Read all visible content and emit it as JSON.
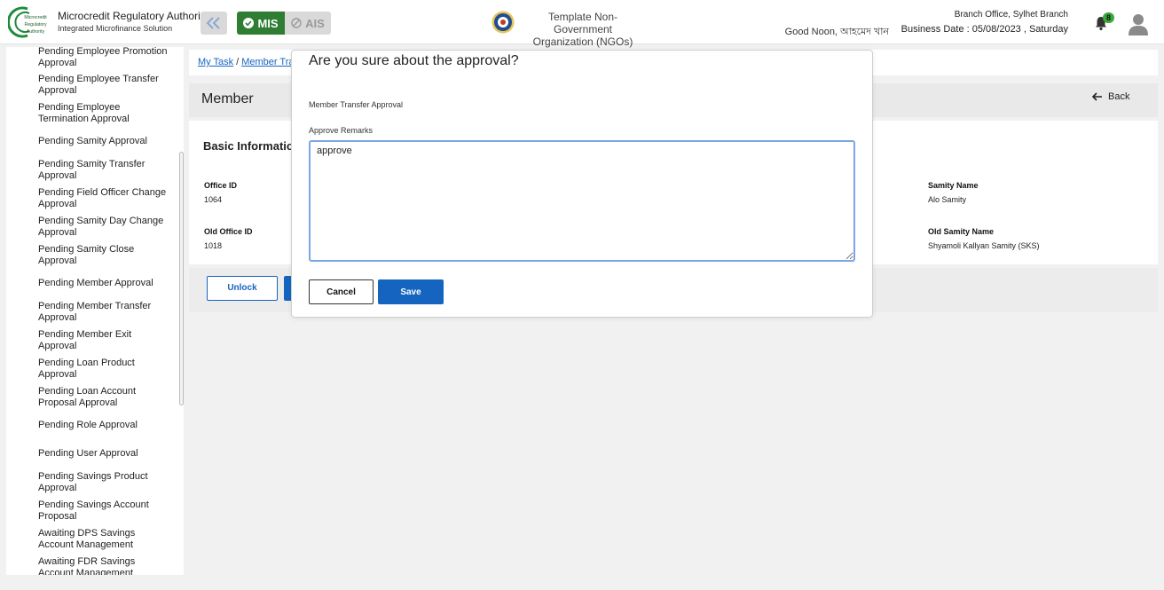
{
  "header": {
    "logo_text": [
      "Microcredit",
      "Regulatory",
      "Authority"
    ],
    "brand_title": "Microcredit Regulatory Authority",
    "brand_subtitle": "Integrated Microfinance Solution",
    "modules": {
      "mis": "MIS",
      "ais": "AIS"
    },
    "org_name_line1": "Template Non-Government",
    "org_name_line2": "Organization (NGOs)",
    "greeting": "Good Noon, আহমেদ খান",
    "branch": "Branch Office, Sylhet Branch",
    "business_date": "Business Date : 05/08/2023 , Saturday",
    "notification_count": "8",
    "colors": {
      "mis": "#2e7d32",
      "primary": "#1565c0",
      "badge": "#3aa83a"
    }
  },
  "sidebar": {
    "items": [
      "Pending Employee Promotion Approval",
      "Pending Employee Transfer Approval",
      "Pending Employee Termination Approval",
      "Pending Samity Approval",
      "Pending Samity Transfer Approval",
      "Pending Field Officer Change Approval",
      "Pending Samity Day Change Approval",
      "Pending Samity Close Approval",
      "Pending Member Approval",
      "Pending Member Transfer Approval",
      "Pending Member Exit Approval",
      "Pending Loan Product Approval",
      "Pending Loan Account Proposal Approval",
      "Pending Role Approval",
      "Pending User Approval",
      "Pending Savings Product Approval",
      "Pending Savings Account Proposal",
      "Awaiting DPS Savings Account Management",
      "Awaiting FDR Savings Account Management"
    ]
  },
  "breadcrumb": {
    "home": "My Task",
    "current": "Member Tran"
  },
  "page": {
    "title": "Member",
    "back_label": "Back",
    "section_title": "Basic Information",
    "fields": {
      "office_id_label": "Office ID",
      "office_id_value": "1064",
      "old_office_id_label": "Old Office ID",
      "old_office_id_value": "1018",
      "samity_name_label": "Samity Name",
      "samity_name_value": "Alo Samity",
      "old_samity_name_label": "Old Samity Name",
      "old_samity_name_value": "Shyamoli Kallyan Samity (SKS)"
    },
    "unlock_label": "Unlock"
  },
  "modal": {
    "title": "Are you sure about the approval?",
    "subtitle": "Member Transfer Approval",
    "remarks_label": "Approve Remarks",
    "remarks_value": "approve",
    "cancel_label": "Cancel",
    "save_label": "Save"
  }
}
